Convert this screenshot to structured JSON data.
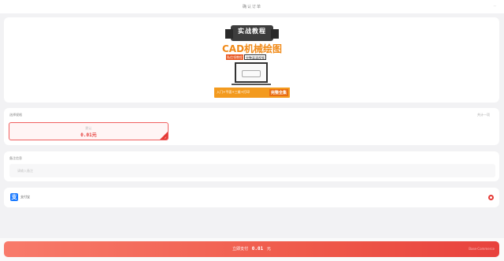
{
  "topbar": {
    "title": "确认订单",
    "more": "··"
  },
  "product": {
    "ribbon_text": "实战教程",
    "main_text": "CAD机械绘图",
    "sub_left": "私信领教程",
    "sub_right": "完整高清视频",
    "bottom_left": "入门+平面+三维+打印",
    "bottom_right": "完整全集"
  },
  "price_section": {
    "label": "选择规格",
    "right_label": "共计一项",
    "option_name": "默认",
    "option_price": "0.01元"
  },
  "remark": {
    "label": "备注信息",
    "placeholder": "请输入备注"
  },
  "payment": {
    "icon_glyph": "支",
    "label": "支付宝"
  },
  "footer": {
    "button_prefix": "立即支付",
    "amount": "0.01",
    "button_suffix": "元",
    "watermark": "Base·Commerce"
  },
  "colors": {
    "accent": "#e53935",
    "alipay": "#1677ff",
    "poster_orange": "#f39a1e"
  }
}
